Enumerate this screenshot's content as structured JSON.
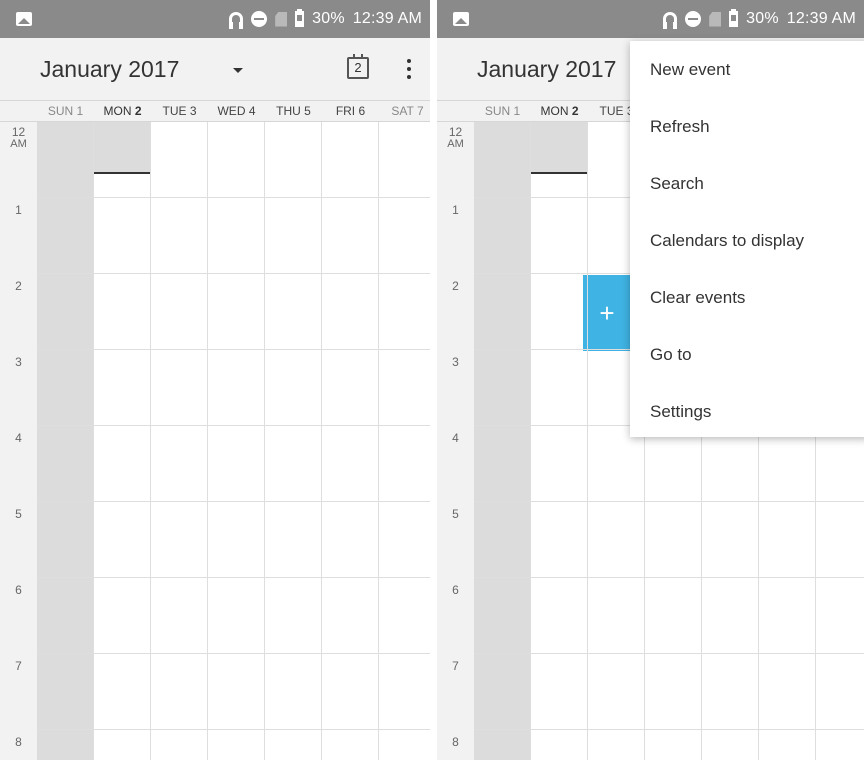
{
  "status_bar": {
    "battery": "30%",
    "time": "12:39 AM"
  },
  "toolbar": {
    "month_title": "January 2017",
    "today_icon_number": "2"
  },
  "day_header": [
    {
      "name": "SUN",
      "num": "1"
    },
    {
      "name": "MON",
      "num": "2"
    },
    {
      "name": "TUE",
      "num": "3"
    },
    {
      "name": "WED",
      "num": "4"
    },
    {
      "name": "THU",
      "num": "5"
    },
    {
      "name": "FRI",
      "num": "6"
    },
    {
      "name": "SAT",
      "num": "7"
    }
  ],
  "hours": [
    "12",
    "1",
    "2",
    "3",
    "4",
    "5",
    "6",
    "7",
    "8"
  ],
  "midnight_suffix": "AM",
  "fab_label": "+",
  "menu_items": [
    "New event",
    "Refresh",
    "Search",
    "Calendars to display",
    "Clear events",
    "Go to",
    "Settings"
  ],
  "colors": {
    "status_bar": "#8a8a8a",
    "toolbar": "#f2f2f2",
    "weekend_column": "#dcdcdc",
    "fab": "#3fb3e3"
  },
  "icons": [
    "image-icon",
    "headphones-icon",
    "do-not-disturb-icon",
    "no-sim-icon",
    "battery-icon",
    "today-calendar-icon",
    "dropdown-arrow-icon",
    "overflow-menu-icon",
    "add-icon"
  ]
}
